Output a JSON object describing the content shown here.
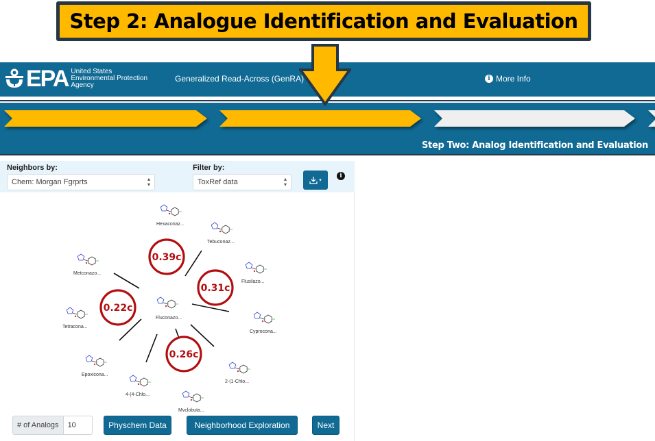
{
  "callout": {
    "banner_text": "Step 2: Analogue Identification and Evaluation",
    "banner_color": "#ffba00",
    "border_color": "#263645"
  },
  "header": {
    "logo_text": "EPA",
    "agency_line1": "United States",
    "agency_line2": "Environmental Protection",
    "agency_line3": "Agency",
    "app_title": "Generalized Read-Across (GenRA)",
    "more_info_label": "More Info",
    "brand_color": "#106a94"
  },
  "stepper": {
    "steps": [
      {
        "state": "complete",
        "color": "#ffba00"
      },
      {
        "state": "active",
        "color": "#ffba00"
      },
      {
        "state": "pending",
        "color": "#efefef"
      },
      {
        "state": "pending",
        "color": "#efefef"
      }
    ],
    "caption": "Step Two: Analog Identification and Evaluation"
  },
  "panel": {
    "neighbors_label": "Neighbors by:",
    "neighbors_value": "Chem: Morgan Fgrprts",
    "filter_label": "Filter by:",
    "filter_value": "ToxRef data",
    "download_icon": "download-icon",
    "info_icon": "info-icon"
  },
  "graph": {
    "center": {
      "label": "Fluconazo..."
    },
    "neighbors": [
      {
        "label": "Hexaconaz..."
      },
      {
        "label": "Tebuconaz..."
      },
      {
        "label": "Flusilazo..."
      },
      {
        "label": "Cyprocona..."
      },
      {
        "label": "2-(1-Chlo..."
      },
      {
        "label": "Myclobuta..."
      },
      {
        "label": "4-(4-Chlo..."
      },
      {
        "label": "Epoxicona..."
      },
      {
        "label": "Tetracona..."
      },
      {
        "label": "Metconazo..."
      }
    ],
    "scores": [
      {
        "text": "0.39c"
      },
      {
        "text": "0.31c"
      },
      {
        "text": "0.22c"
      },
      {
        "text": "0.26c"
      }
    ],
    "score_color": "#b20e10"
  },
  "controls": {
    "analogs_label": "# of Analogs",
    "analogs_value": "10",
    "physchem_button": "Physchem Data",
    "neighborhood_button": "Neighborhood Exploration",
    "next_button": "Next"
  }
}
